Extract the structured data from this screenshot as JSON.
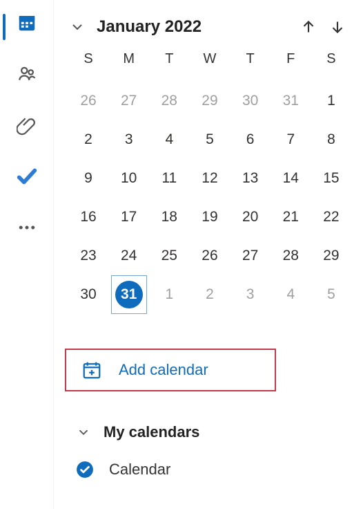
{
  "nav": {
    "items": [
      {
        "id": "calendar",
        "active": true
      },
      {
        "id": "people"
      },
      {
        "id": "attachments"
      },
      {
        "id": "tasks"
      },
      {
        "id": "more"
      }
    ]
  },
  "header": {
    "month_label": "January 2022"
  },
  "calendar": {
    "dow": [
      "S",
      "M",
      "T",
      "W",
      "T",
      "F",
      "S"
    ],
    "weeks": [
      [
        {
          "n": 26,
          "other": true
        },
        {
          "n": 27,
          "other": true
        },
        {
          "n": 28,
          "other": true
        },
        {
          "n": 29,
          "other": true
        },
        {
          "n": 30,
          "other": true
        },
        {
          "n": 31,
          "other": true
        },
        {
          "n": 1
        }
      ],
      [
        {
          "n": 2
        },
        {
          "n": 3
        },
        {
          "n": 4
        },
        {
          "n": 5
        },
        {
          "n": 6
        },
        {
          "n": 7
        },
        {
          "n": 8
        }
      ],
      [
        {
          "n": 9
        },
        {
          "n": 10
        },
        {
          "n": 11
        },
        {
          "n": 12
        },
        {
          "n": 13
        },
        {
          "n": 14
        },
        {
          "n": 15
        }
      ],
      [
        {
          "n": 16
        },
        {
          "n": 17
        },
        {
          "n": 18
        },
        {
          "n": 19
        },
        {
          "n": 20
        },
        {
          "n": 21
        },
        {
          "n": 22
        }
      ],
      [
        {
          "n": 23
        },
        {
          "n": 24
        },
        {
          "n": 25
        },
        {
          "n": 26
        },
        {
          "n": 27
        },
        {
          "n": 28
        },
        {
          "n": 29
        }
      ],
      [
        {
          "n": 30
        },
        {
          "n": 31,
          "today": true
        },
        {
          "n": 1,
          "other": true
        },
        {
          "n": 2,
          "other": true
        },
        {
          "n": 3,
          "other": true
        },
        {
          "n": 4,
          "other": true
        },
        {
          "n": 5,
          "other": true
        }
      ]
    ]
  },
  "add_calendar": {
    "label": "Add calendar"
  },
  "sections": {
    "my_calendars": {
      "title": "My calendars",
      "items": [
        {
          "label": "Calendar",
          "checked": true,
          "color": "#0F6CBD"
        }
      ]
    }
  }
}
